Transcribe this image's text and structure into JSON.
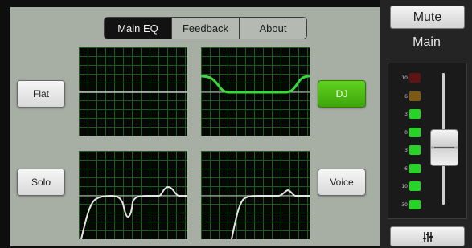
{
  "tabs": [
    {
      "label": "Main EQ",
      "active": true
    },
    {
      "label": "Feedback",
      "active": false
    },
    {
      "label": "About",
      "active": false
    }
  ],
  "presets": {
    "flat": "Flat",
    "dj": "DJ",
    "solo": "Solo",
    "voice": "Voice"
  },
  "active_preset": "DJ",
  "side": {
    "mute_label": "Mute",
    "channel_label": "Main",
    "meter_labels": [
      "10",
      "6",
      "3",
      "0",
      "3",
      "6",
      "10",
      "30"
    ],
    "meter_led_colors": [
      "#5c1414",
      "#7a5a15",
      "#27d327",
      "#27d327",
      "#27d327",
      "#27d327",
      "#27d327",
      "#27d327"
    ],
    "settings_icon": "mixer-sliders-icon"
  },
  "colors": {
    "active_green": "#4fbd13",
    "curve_active": "#39d83b",
    "curve_inactive": "#e5e5e5",
    "grid": "#1c5c1c",
    "background": "#a7aea4"
  }
}
